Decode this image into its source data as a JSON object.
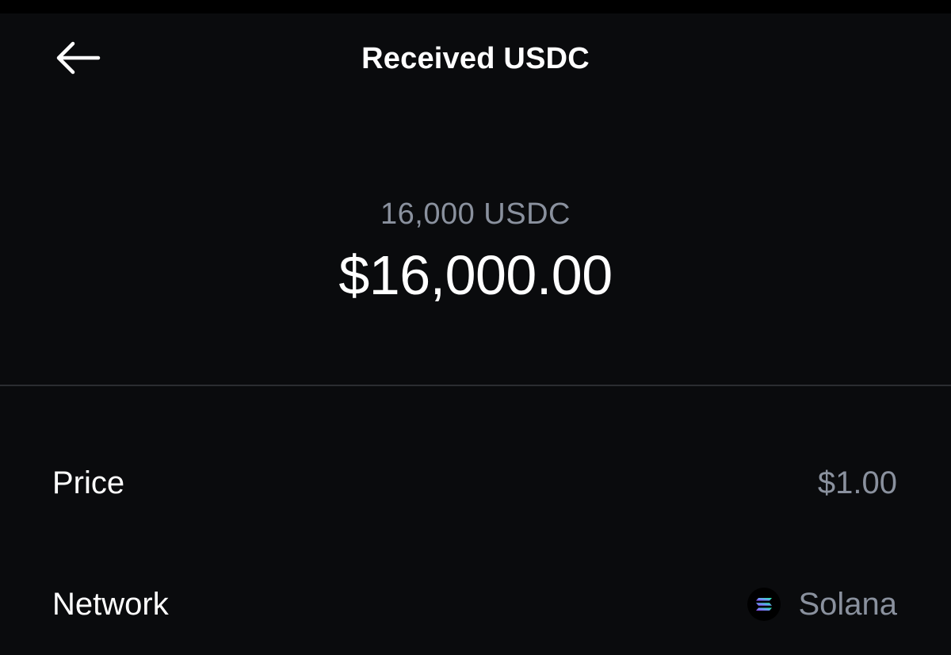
{
  "header": {
    "title": "Received USDC",
    "back_icon": "arrow-left-icon"
  },
  "amount": {
    "crypto": "16,000 USDC",
    "fiat": "$16,000.00"
  },
  "details": {
    "price": {
      "label": "Price",
      "value": "$1.00"
    },
    "network": {
      "label": "Network",
      "value": "Solana",
      "icon": "solana-icon"
    }
  },
  "colors": {
    "background": "#0a0b0d",
    "primary_text": "#ffffff",
    "secondary_text": "#8a919e",
    "divider": "#2b2d31"
  }
}
